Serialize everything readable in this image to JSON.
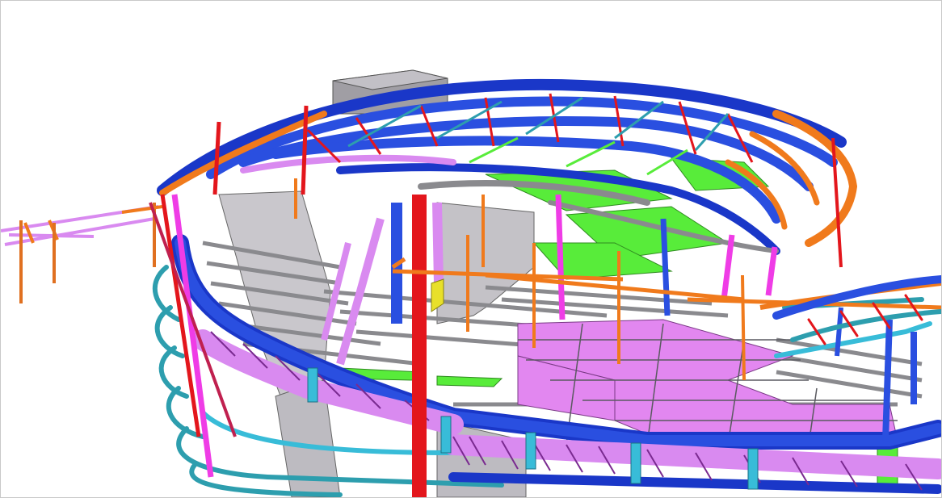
{
  "viewport": {
    "background": "#ffffff",
    "border": "#c8c8c8"
  },
  "model": {
    "colors": {
      "blue": "#2a4fe0",
      "dark_blue": "#1a37c8",
      "orange": "#f07a1c",
      "red": "#e3161c",
      "magenta": "#ef3ce6",
      "violet": "#d98af0",
      "green": "#58ec3a",
      "teal": "#2d9eae",
      "cyan": "#38bcd8",
      "grey": "#8a8a8e",
      "light_grey": "#c8c6cc",
      "dark_grey": "#6d6d72",
      "yellow": "#e8e02a"
    }
  }
}
